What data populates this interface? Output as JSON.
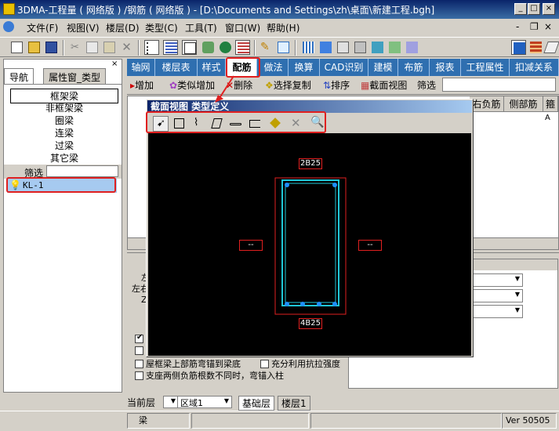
{
  "window": {
    "title": "3DMA-工程量 ( 网络版 ) /钢筋 ( 网络版 ) - [D:\\Documents and Settings\\zh\\桌面\\新建工程.bgh]",
    "minimize": "_",
    "maximize": "□",
    "close": "×",
    "sub_minimize": "-",
    "sub_restore": "❐",
    "sub_close": "×"
  },
  "menu": [
    {
      "label": "文件(F)"
    },
    {
      "label": "视图(V)"
    },
    {
      "label": "楼层(D)"
    },
    {
      "label": "类型(C)"
    },
    {
      "label": "工具(T)"
    },
    {
      "label": "窗口(W)"
    },
    {
      "label": "帮助(H)"
    }
  ],
  "left_panel": {
    "tabs": [
      "导航",
      "属性窗_类型"
    ],
    "close": "×",
    "items": [
      "框架梁",
      "非框架梁",
      "圈梁",
      "连梁",
      "过梁",
      "其它梁"
    ],
    "filter_label": "筛选",
    "selected_item": "KL-1"
  },
  "top_nav": {
    "tabs": [
      "轴网",
      "楼层表",
      "样式",
      "配筋",
      "做法",
      "换算",
      "CAD识别",
      "建模",
      "布筋",
      "报表",
      "工程属性",
      "扣减关系"
    ],
    "active": "配筋"
  },
  "sub_toolbar": {
    "add": "增加",
    "similar_add": "类似增加",
    "delete": "删除",
    "select_copy": "选择复制",
    "sort": "排序",
    "section_view": "截面视图",
    "filter": "筛选"
  },
  "grid": {
    "headers": [
      "右负筋",
      "侧部筋",
      "箍"
    ],
    "cell_a": "A"
  },
  "dialog": {
    "title": "截面视图 类型定义",
    "tools": [
      "pointer-tool",
      "rectangle-tool",
      "polyline-tool",
      "parallelogram-tool",
      "line-tool",
      "bracket-tool",
      "paint-tool",
      "delete-tool",
      "zoom-tool"
    ],
    "top_rebar": "2B25",
    "bottom_rebar": "4B25",
    "left_dim": "--",
    "right_dim": "--"
  },
  "lower_panel": {
    "frag1": "左",
    "frag2": "左右",
    "frag3": "Z",
    "option_roof_beam": "屋框梁上部筋弯锚到梁底",
    "option_full_use": "充分利用抗拉强度",
    "option_support": "支座两侧负筋根数不同时，弯锚入柱"
  },
  "floor_bar": {
    "current_floor_label": "当前层",
    "region": "区域1",
    "tabs": [
      "基础层",
      "楼层1"
    ]
  },
  "status": {
    "component": "梁",
    "version": "Ver 50505"
  },
  "colors": {
    "nav_blue": "#2f6fb0",
    "highlight_red": "#e02020",
    "rebar_blue": "#1e90ff",
    "section_cyan": "#20c8d8"
  }
}
